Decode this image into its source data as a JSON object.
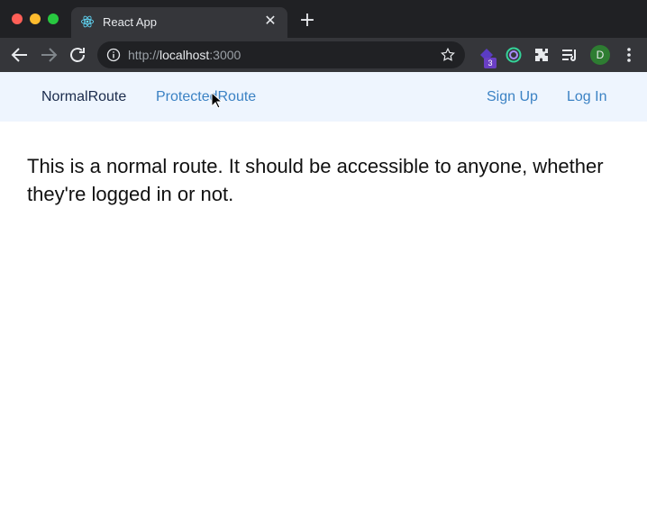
{
  "browser": {
    "tab": {
      "title": "React App",
      "favicon": "react-icon",
      "close_icon": "close-icon"
    },
    "new_tab_icon": "plus-icon",
    "url": {
      "scheme": "http://",
      "host": "localhost",
      "port": ":3000"
    },
    "extension_badge": "3",
    "profile_initial": "D",
    "colors": {
      "chrome_dark": "#202124",
      "chrome_toolbar": "#35363a",
      "profile": "#2e7d32"
    }
  },
  "navbar": {
    "normal_route": "NormalRoute",
    "protected_route": "ProtectedRoute",
    "sign_up": "Sign Up",
    "log_in": "Log In",
    "colors": {
      "background": "#eef5fe",
      "link": "#3b82c4",
      "active": "#1a2b4c"
    }
  },
  "main": {
    "message": "This is a normal route. It should be accessible to anyone, whether they're logged in or not."
  }
}
